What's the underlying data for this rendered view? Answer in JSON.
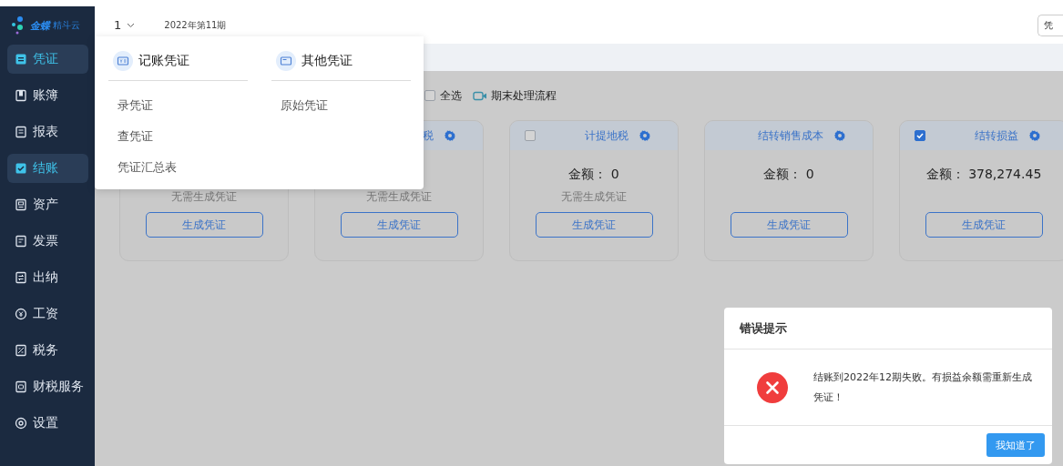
{
  "sidebar": {
    "logo": {
      "brand": "金蝶",
      "product": "精斗云"
    },
    "items": [
      {
        "label": "凭证",
        "selected": true
      },
      {
        "label": "账簿",
        "selected": false
      },
      {
        "label": "报表",
        "selected": false
      },
      {
        "label": "结账",
        "selected": true
      },
      {
        "label": "资产",
        "selected": false
      },
      {
        "label": "发票",
        "selected": false
      },
      {
        "label": "出纳",
        "selected": false
      },
      {
        "label": "工资",
        "selected": false
      },
      {
        "label": "税务",
        "selected": false
      },
      {
        "label": "财税服务",
        "selected": false
      },
      {
        "label": "设置",
        "selected": false
      }
    ]
  },
  "header": {
    "account": "1",
    "period": "2022年第11期",
    "right_button": "凭"
  },
  "menu": {
    "columns": [
      {
        "title": "记账凭证",
        "items": [
          "录凭证",
          "查凭证",
          "凭证汇总表"
        ]
      },
      {
        "title": "其他凭证",
        "items": [
          "原始凭证"
        ]
      }
    ]
  },
  "toolbar": {
    "select_all": {
      "label": "全选",
      "checked": false
    },
    "flow_link": "期末处理流程"
  },
  "cards": [
    {
      "note": "无需生成凭证",
      "button": "生成凭证"
    },
    {
      "title": "税",
      "note": "无需生成凭证",
      "button": "生成凭证"
    },
    {
      "title": "计提地税",
      "checked": false,
      "amount": "金额： 0",
      "note": "无需生成凭证",
      "button": "生成凭证"
    },
    {
      "title": "结转销售成本",
      "amount": "金额： 0",
      "button": "生成凭证"
    },
    {
      "title": "结转损益",
      "checked": true,
      "amount": "金额： 378,274.45",
      "button": "生成凭证"
    }
  ],
  "dialog": {
    "title": "错误提示",
    "message": "结账到2022年12期失败。有损益余额需重新生成凭证！",
    "button": "我知道了"
  }
}
